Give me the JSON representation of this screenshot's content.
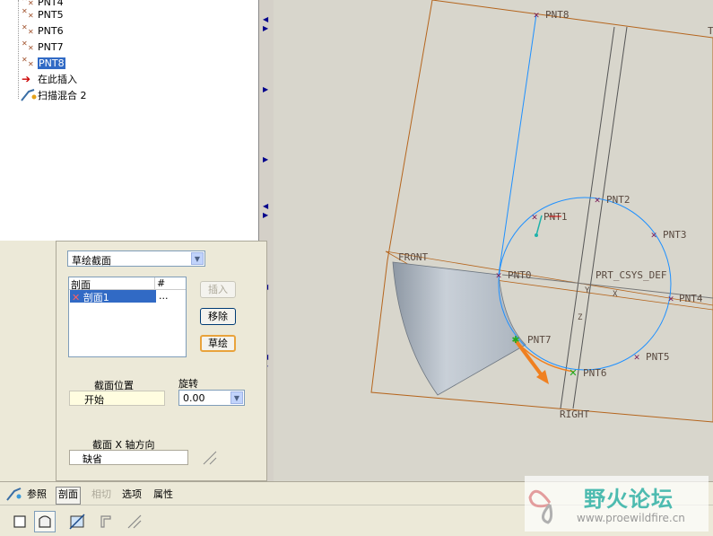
{
  "tree": {
    "items": [
      {
        "label": "PNT4",
        "selected": false
      },
      {
        "label": "PNT5",
        "selected": false
      },
      {
        "label": "PNT6",
        "selected": false
      },
      {
        "label": "PNT7",
        "selected": false
      },
      {
        "label": "PNT8",
        "selected": true
      }
    ],
    "insert_here": "在此插入",
    "feature": "扫描混合 2"
  },
  "panel": {
    "mode_select": "草绘截面",
    "list_header_name": "剖面",
    "list_header_num": "#",
    "list_rows": [
      {
        "name": "剖面1",
        "num": "..."
      }
    ],
    "insert_button": "插入",
    "remove_button": "移除",
    "sketch_button": "草绘",
    "position_label": "截面位置",
    "position_value": "开始",
    "rotation_label": "旋转",
    "rotation_value": "0.00",
    "xaxis_label": "截面 X 轴方向",
    "xaxis_value": "缺省"
  },
  "tabs": [
    {
      "label": "参照",
      "current": false,
      "disabled": false
    },
    {
      "label": "剖面",
      "current": true,
      "disabled": false
    },
    {
      "label": "相切",
      "current": false,
      "disabled": true
    },
    {
      "label": "选项",
      "current": false,
      "disabled": false
    },
    {
      "label": "属性",
      "current": false,
      "disabled": false
    }
  ],
  "graphics": {
    "points": [
      "PNT8",
      "PNT1",
      "PNT2",
      "PNT3",
      "PNT4",
      "PNT5",
      "PNT6",
      "PNT7",
      "PNT0"
    ],
    "datum_planes": [
      "FRONT",
      "RIGHT",
      "T"
    ],
    "csys": "PRT_CSYS_DEF",
    "axis_labels": [
      "Y",
      "X",
      "Z"
    ]
  },
  "watermark": {
    "title": "野火论坛",
    "url": "www.proewildfire.cn"
  },
  "colors": {
    "datum_orange": "#b5651d",
    "curve_blue": "#1e90ff",
    "selection_blue": "#316ac5",
    "point_purple": "#7b1f5b",
    "start_green": "#22aa22",
    "arrow_orange": "#f08020"
  }
}
